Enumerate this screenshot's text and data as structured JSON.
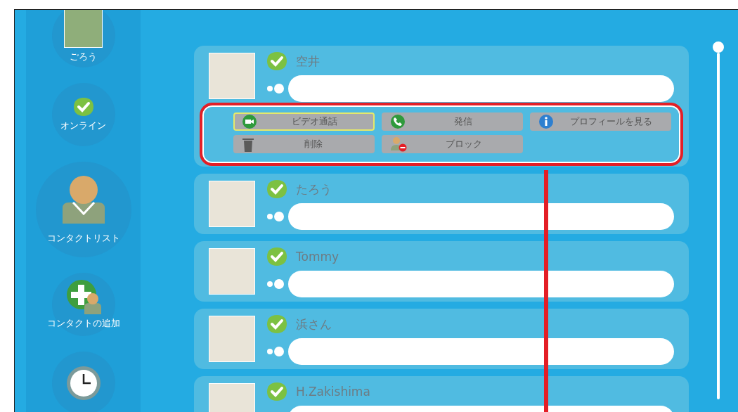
{
  "sidebar": {
    "items": [
      {
        "kind": "avatar",
        "label": "ごろう"
      },
      {
        "kind": "status",
        "label": "オンライン"
      },
      {
        "kind": "contacts",
        "label": "コンタクトリスト"
      },
      {
        "kind": "add",
        "label": "コンタクトの追加"
      },
      {
        "kind": "history"
      }
    ]
  },
  "contacts": [
    {
      "name": "空井",
      "online": true,
      "expanded": true
    },
    {
      "name": "たろう",
      "online": true,
      "expanded": false
    },
    {
      "name": "Tommy",
      "online": true,
      "expanded": false
    },
    {
      "name": "浜さん",
      "online": true,
      "expanded": false
    },
    {
      "name": "H.Zakishima",
      "online": true,
      "expanded": false
    }
  ],
  "actions": [
    {
      "kind": "video",
      "label": "ビデオ通話",
      "selected": true
    },
    {
      "kind": "call",
      "label": "発信",
      "selected": false
    },
    {
      "kind": "profile",
      "label": "プロフィールを見る",
      "selected": false
    },
    {
      "kind": "delete",
      "label": "削除",
      "selected": false
    },
    {
      "kind": "block",
      "label": "ブロック",
      "selected": false
    }
  ],
  "callout": {
    "shown": true
  }
}
